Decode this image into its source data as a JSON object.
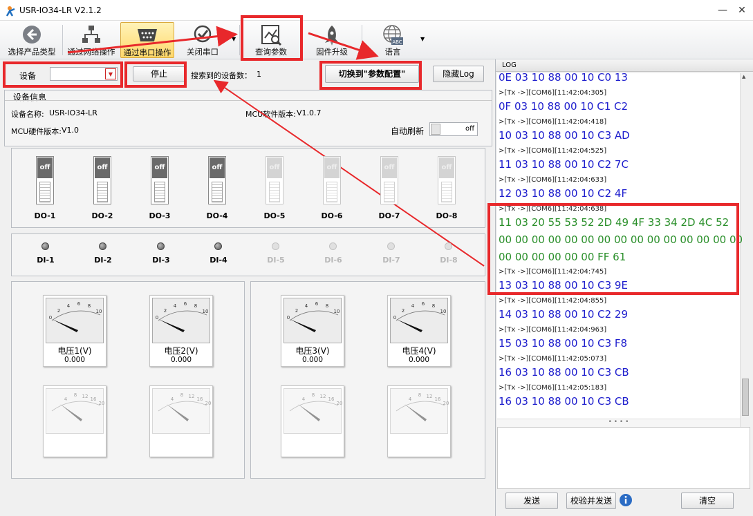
{
  "window": {
    "title": "USR-IO34-LR V2.1.2"
  },
  "toolbar": {
    "items": [
      {
        "label": "选择产品类型",
        "icon": "back-arrow-icon"
      },
      {
        "label": "通过网络操作",
        "icon": "network-icon"
      },
      {
        "label": "通过串口操作",
        "icon": "serial-port-icon"
      },
      {
        "label": "关闭串口",
        "icon": "checkmark-icon"
      },
      {
        "label": "查询参数",
        "icon": "query-chart-icon"
      },
      {
        "label": "固件升级",
        "icon": "rocket-icon"
      },
      {
        "label": "语言",
        "icon": "globe-abc-icon"
      }
    ]
  },
  "device_bar": {
    "device_label": "设备",
    "stop_label": "停止",
    "search_count_label": "搜索到的设备数：",
    "search_count": "1",
    "switch_label": "切换到\"参数配置\"",
    "hide_log_label": "隐藏Log"
  },
  "device_info": {
    "section_title": "设备信息",
    "name_label": "设备名称:",
    "name": "USR-IO34-LR",
    "mcu_sw_label": "MCU软件版本:",
    "mcu_sw": "V1.0.7",
    "mcu_hw_label": "MCU硬件版本:",
    "mcu_hw": "V1.0",
    "auto_refresh_label": "自动刷新",
    "auto_refresh_value": "off"
  },
  "do_switches": [
    {
      "label": "DO-1",
      "state": "off"
    },
    {
      "label": "DO-2",
      "state": "off"
    },
    {
      "label": "DO-3",
      "state": "off"
    },
    {
      "label": "DO-4",
      "state": "off"
    },
    {
      "label": "DO-5",
      "state": "off"
    },
    {
      "label": "DO-6",
      "state": "off"
    },
    {
      "label": "DO-7",
      "state": "off"
    },
    {
      "label": "DO-8",
      "state": "off"
    }
  ],
  "di_inputs": [
    {
      "label": "DI-1"
    },
    {
      "label": "DI-2"
    },
    {
      "label": "DI-3"
    },
    {
      "label": "DI-4"
    },
    {
      "label": "DI-5"
    },
    {
      "label": "DI-6"
    },
    {
      "label": "DI-7"
    },
    {
      "label": "DI-8"
    }
  ],
  "gauges": [
    {
      "label": "电压1(V)",
      "value": "0.000"
    },
    {
      "label": "电压2(V)",
      "value": "0.000"
    },
    {
      "label": "电压3(V)",
      "value": "0.000"
    },
    {
      "label": "电压4(V)",
      "value": "0.000"
    }
  ],
  "gauge_scale": {
    "t0": "0",
    "t2": "2",
    "t4": "4",
    "t6": "6",
    "t8": "8",
    "t10": "10",
    "d4": "4",
    "d8": "8",
    "d12": "12",
    "d16": "16",
    "d20": "20"
  },
  "log": {
    "title": "LOG",
    "send_label": "发送",
    "verify_send_label": "校验并发送",
    "clear_label": "清空",
    "info_icon": "info-icon",
    "lines": [
      {
        "type": "hex",
        "text": "0E 03 10 88 00 10 C0 13"
      },
      {
        "type": "tx",
        "text": ">[Tx ->][COM6][11:42:04:305]"
      },
      {
        "type": "hex",
        "text": "0F 03 10 88 00 10 C1 C2"
      },
      {
        "type": "tx",
        "text": ">[Tx ->][COM6][11:42:04:418]"
      },
      {
        "type": "hex",
        "text": "10 03 10 88 00 10 C3 AD"
      },
      {
        "type": "tx",
        "text": ">[Tx ->][COM6][11:42:04:525]"
      },
      {
        "type": "hex",
        "text": "11 03 10 88 00 10 C2 7C"
      },
      {
        "type": "tx",
        "text": ">[Tx ->][COM6][11:42:04:633]"
      },
      {
        "type": "hex",
        "text": "12 03 10 88 00 10 C2 4F"
      },
      {
        "type": "tx",
        "text": ">[Tx ->][COM6][11:42:04:638]"
      },
      {
        "type": "rx",
        "text": "11 03 20 55 53 52 2D 49 4F 33 34 2D 4C 52"
      },
      {
        "type": "rx",
        "text": "00 00 00 00 00 00 00 00 00 00 00 00 00 00 00"
      },
      {
        "type": "rx",
        "text": "00 00 00 00 00 00 FF 61"
      },
      {
        "type": "tx",
        "text": ">[Tx ->][COM6][11:42:04:745]"
      },
      {
        "type": "hex",
        "text": "13 03 10 88 00 10 C3 9E"
      },
      {
        "type": "tx",
        "text": ">[Tx ->][COM6][11:42:04:855]"
      },
      {
        "type": "hex",
        "text": "14 03 10 88 00 10 C2 29"
      },
      {
        "type": "tx",
        "text": ">[Tx ->][COM6][11:42:04:963]"
      },
      {
        "type": "hex",
        "text": "15 03 10 88 00 10 C3 F8"
      },
      {
        "type": "tx",
        "text": ">[Tx ->][COM6][11:42:05:073]"
      },
      {
        "type": "hex",
        "text": "16 03 10 88 00 10 C3 CB"
      },
      {
        "type": "tx",
        "text": ">[Tx ->][COM6][11:42:05:183]"
      },
      {
        "type": "hex",
        "text": "16 03 10 88 00 10 C3 CB"
      },
      {
        "type": "tx",
        "text": ">[Tx ->][COM6][11:42:05:183]"
      }
    ]
  },
  "colors": {
    "annotation": "#e8282b",
    "hex_text": "#1d1dcd",
    "rx_text": "#2a8f2a",
    "active_button": "#ffd86b"
  }
}
